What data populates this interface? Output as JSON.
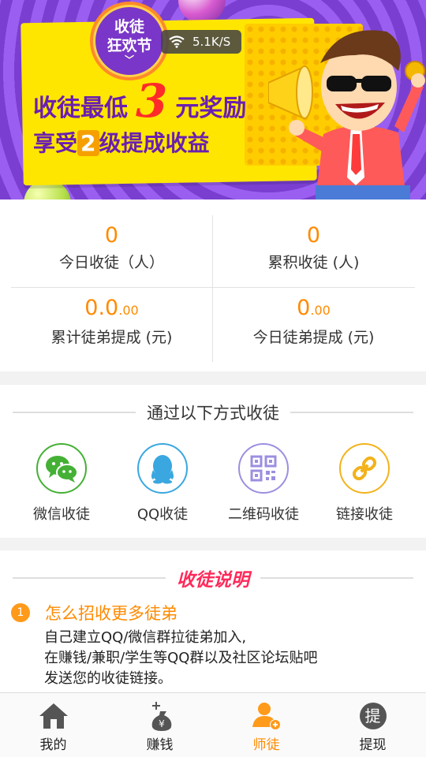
{
  "banner": {
    "badge_line1": "收徒",
    "badge_line2": "狂欢节",
    "badge_chevron": "﹀",
    "headline_pre": "收徒最低",
    "headline_num": "3",
    "headline_post": "元奖励",
    "sub_pre": "享受",
    "sub_num": "2",
    "sub_post": "级提成收益",
    "network_speed": "5.1K/S"
  },
  "stats": {
    "today_invites_value": "0",
    "today_invites_label": "今日收徒（人）",
    "total_invites_value": "0",
    "total_invites_label": "累积收徒 (人)",
    "total_commission_int": "0.0",
    "total_commission_dec": ".00",
    "total_commission_label": "累计徒弟提成 (元)",
    "today_commission_int": "0",
    "today_commission_dec": ".00",
    "today_commission_label": "今日徒弟提成 (元)"
  },
  "invite": {
    "title": "通过以下方式收徒",
    "methods": [
      {
        "label": "微信收徒",
        "icon": "wechat-icon",
        "color": "#44b035"
      },
      {
        "label": "QQ收徒",
        "icon": "qq-icon",
        "color": "#3aa7e0"
      },
      {
        "label": "二维码收徒",
        "icon": "qrcode-icon",
        "color": "#9b8fe0"
      },
      {
        "label": "链接收徒",
        "icon": "link-icon",
        "color": "#f3b21b"
      }
    ]
  },
  "explain": {
    "title": "收徒说明",
    "items": [
      {
        "num": "1",
        "question": "怎么招收更多徒弟",
        "answer_lines": [
          "自己建立QQ/微信群拉徒弟加入,",
          "在赚钱/兼职/学生等QQ群以及社区论坛贴吧",
          "发送您的收徒链接。"
        ]
      }
    ]
  },
  "tabbar": {
    "tabs": [
      {
        "label": "我的",
        "icon": "home-icon",
        "active": false
      },
      {
        "label": "赚钱",
        "icon": "money-bag-icon",
        "active": false
      },
      {
        "label": "师徒",
        "icon": "add-user-icon",
        "active": true
      },
      {
        "label": "提现",
        "icon": "withdraw-icon",
        "active": false
      }
    ],
    "withdraw_glyph": "提"
  },
  "colors": {
    "accent": "#ff8a00",
    "banner_purple": "#7a3fd0",
    "banner_yellow": "#ffe600",
    "explain_title": "#ff2a5a"
  }
}
